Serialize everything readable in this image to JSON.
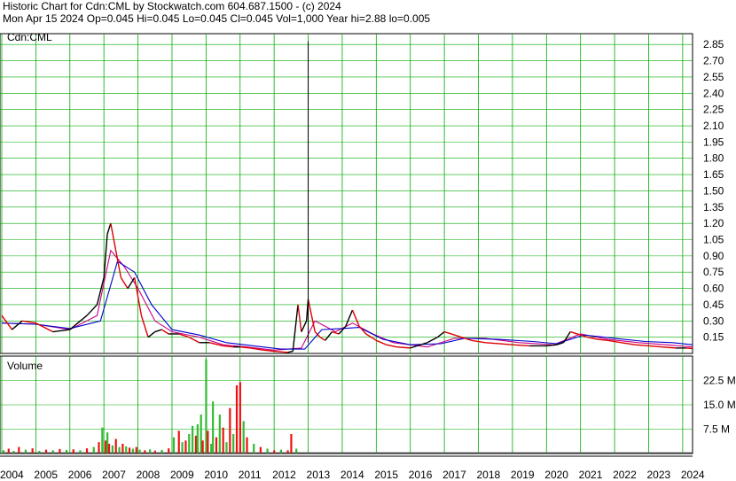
{
  "header": {
    "line1": "Historic Chart for Cdn:CML by Stockwatch.com 604.687.1500 - (c) 2024",
    "line2": "Mon Apr 15 2024   Op=0.045  Hi=0.045  Lo=0.045  Cl=0.045  Vol=1,000   Year hi=2.88  lo=0.005"
  },
  "colors": {
    "grid": "#00aa00",
    "price_black": "#000000",
    "price_red": "#dd0000",
    "ma_magenta": "#cc0088",
    "ma_blue": "#0000cc",
    "vol_green": "#33bb33",
    "vol_red": "#ee1111"
  },
  "chart_data": [
    {
      "type": "line",
      "title": "Cdn:CML",
      "x_years": [
        "2004",
        "2005",
        "2006",
        "2007",
        "2008",
        "2009",
        "2010",
        "2011",
        "2012",
        "2013",
        "2014",
        "2015",
        "2016",
        "2017",
        "2018",
        "2019",
        "2020",
        "2021",
        "2022",
        "2023",
        "2024"
      ],
      "ylim": [
        0,
        2.95
      ],
      "yticks": [
        "0.15",
        "0.30",
        "0.45",
        "0.60",
        "0.75",
        "0.90",
        "1.05",
        "1.20",
        "1.35",
        "1.50",
        "1.65",
        "1.80",
        "1.95",
        "2.10",
        "2.25",
        "2.40",
        "2.55",
        "2.70",
        "2.85"
      ],
      "grid": true,
      "series": [
        {
          "x": [
            2004.0,
            2004.3,
            2004.6,
            2005.0,
            2005.5,
            2006.0,
            2006.5,
            2006.8,
            2007.0,
            2007.1,
            2007.2,
            2007.35,
            2007.5,
            2007.7,
            2007.9,
            2008.1,
            2008.3,
            2008.5,
            2008.7,
            2008.9,
            2009.2,
            2009.5,
            2009.8,
            2010.1,
            2010.5,
            2010.8,
            2011.0,
            2011.3,
            2011.7,
            2012.0,
            2012.4,
            2012.55,
            2012.7,
            2012.8,
            2012.95,
            2013.0,
            2013.1,
            2013.2,
            2013.35,
            2013.5,
            2013.7,
            2013.9,
            2014.1,
            2014.3,
            2014.5,
            2014.7,
            2015.0,
            2015.3,
            2015.6,
            2016.0,
            2016.5,
            2016.8,
            2017.0,
            2017.2,
            2017.5,
            2017.8,
            2018.2,
            2018.6,
            2019.0,
            2019.5,
            2020.0,
            2020.3,
            2020.5,
            2020.7,
            2020.9,
            2021.2,
            2021.5,
            2021.8,
            2022.2,
            2022.6,
            2023.0,
            2023.4,
            2023.8,
            2024.1,
            2024.29
          ],
          "values": [
            0.35,
            0.22,
            0.3,
            0.28,
            0.2,
            0.22,
            0.35,
            0.45,
            0.7,
            1.1,
            1.2,
            0.95,
            0.7,
            0.6,
            0.7,
            0.35,
            0.15,
            0.2,
            0.22,
            0.18,
            0.18,
            0.15,
            0.1,
            0.1,
            0.07,
            0.06,
            0.06,
            0.05,
            0.03,
            0.02,
            0.01,
            0.02,
            0.45,
            0.2,
            0.3,
            0.5,
            0.35,
            0.2,
            0.15,
            0.12,
            0.2,
            0.18,
            0.25,
            0.4,
            0.25,
            0.18,
            0.12,
            0.08,
            0.06,
            0.05,
            0.1,
            0.15,
            0.2,
            0.18,
            0.15,
            0.12,
            0.1,
            0.09,
            0.08,
            0.07,
            0.07,
            0.08,
            0.1,
            0.2,
            0.18,
            0.15,
            0.13,
            0.12,
            0.1,
            0.08,
            0.07,
            0.06,
            0.05,
            0.05,
            0.045
          ]
        },
        {
          "x": [
            2004.0,
            2005.0,
            2006.0,
            2006.8,
            2007.2,
            2007.6,
            2008.0,
            2008.5,
            2009.0,
            2009.8,
            2010.5,
            2011.2,
            2012.0,
            2012.8,
            2013.2,
            2013.8,
            2014.3,
            2014.9,
            2015.5,
            2016.5,
            2017.3,
            2018.2,
            2019.2,
            2020.2,
            2021.0,
            2021.8,
            2022.7,
            2023.5,
            2024.29
          ],
          "values": [
            0.28,
            0.27,
            0.22,
            0.35,
            0.95,
            0.8,
            0.6,
            0.3,
            0.2,
            0.15,
            0.08,
            0.06,
            0.03,
            0.05,
            0.3,
            0.2,
            0.28,
            0.18,
            0.1,
            0.06,
            0.14,
            0.14,
            0.1,
            0.08,
            0.18,
            0.13,
            0.1,
            0.08,
            0.06
          ]
        },
        {
          "x": [
            2004.0,
            2005.0,
            2006.0,
            2006.9,
            2007.4,
            2007.9,
            2008.4,
            2009.0,
            2009.8,
            2010.6,
            2011.4,
            2012.2,
            2012.9,
            2013.4,
            2014.0,
            2014.5,
            2015.2,
            2016.0,
            2016.9,
            2017.6,
            2018.6,
            2019.6,
            2020.3,
            2021.1,
            2022.0,
            2022.9,
            2023.7,
            2024.29
          ],
          "values": [
            0.28,
            0.27,
            0.23,
            0.3,
            0.85,
            0.75,
            0.45,
            0.22,
            0.17,
            0.1,
            0.07,
            0.04,
            0.04,
            0.22,
            0.23,
            0.24,
            0.13,
            0.08,
            0.09,
            0.14,
            0.13,
            0.11,
            0.09,
            0.17,
            0.14,
            0.11,
            0.1,
            0.08
          ]
        }
      ]
    },
    {
      "type": "bar",
      "title": "Volume",
      "ylim": [
        0,
        30
      ],
      "yticks": [
        "7.5 M",
        "15.0 M",
        "22.5 M"
      ],
      "grid": true,
      "x": [
        2004.05,
        2004.2,
        2004.35,
        2004.5,
        2004.7,
        2004.9,
        2005.1,
        2005.3,
        2005.5,
        2005.7,
        2005.9,
        2006.1,
        2006.3,
        2006.5,
        2006.7,
        2006.85,
        2006.95,
        2007.05,
        2007.1,
        2007.15,
        2007.25,
        2007.35,
        2007.45,
        2007.55,
        2007.65,
        2007.75,
        2007.85,
        2007.95,
        2008.05,
        2008.2,
        2008.35,
        2008.5,
        2008.7,
        2008.9,
        2009.05,
        2009.2,
        2009.3,
        2009.4,
        2009.5,
        2009.6,
        2009.7,
        2009.75,
        2009.85,
        2009.9,
        2010.0,
        2010.05,
        2010.15,
        2010.2,
        2010.3,
        2010.4,
        2010.5,
        2010.6,
        2010.7,
        2010.8,
        2010.9,
        2011.0,
        2011.1,
        2011.2,
        2011.4,
        2011.6,
        2011.8,
        2012.0,
        2012.2,
        2012.4,
        2012.5,
        2012.65
      ],
      "values": [
        1.0,
        1.5,
        0.8,
        2.0,
        1.2,
        1.6,
        0.8,
        1.2,
        1.0,
        1.4,
        1.1,
        1.3,
        1.0,
        1.6,
        2.0,
        3.5,
        8.0,
        4.0,
        6.5,
        3.0,
        2.5,
        4.5,
        2.0,
        3.0,
        2.2,
        1.8,
        1.5,
        2.0,
        1.2,
        1.0,
        1.3,
        0.9,
        1.1,
        1.6,
        5.0,
        7.0,
        3.5,
        4.0,
        6.0,
        8.5,
        5.5,
        9.0,
        12.0,
        4.0,
        29.0,
        7.0,
        3.0,
        16.0,
        5.0,
        12.0,
        8.0,
        3.5,
        14.0,
        6.0,
        21.0,
        22.0,
        10.0,
        5.0,
        3.0,
        2.0,
        1.5,
        1.0,
        1.2,
        1.0,
        6.0,
        1.5
      ],
      "colors": [
        "g",
        "r",
        "g",
        "r",
        "g",
        "r",
        "g",
        "r",
        "g",
        "r",
        "g",
        "r",
        "g",
        "r",
        "g",
        "r",
        "g",
        "r",
        "g",
        "r",
        "g",
        "r",
        "g",
        "r",
        "g",
        "r",
        "g",
        "r",
        "g",
        "r",
        "g",
        "r",
        "g",
        "r",
        "g",
        "r",
        "g",
        "r",
        "g",
        "g",
        "r",
        "g",
        "g",
        "r",
        "g",
        "r",
        "g",
        "g",
        "r",
        "g",
        "r",
        "g",
        "r",
        "g",
        "r",
        "r",
        "g",
        "r",
        "g",
        "r",
        "g",
        "r",
        "g",
        "r",
        "r",
        "g"
      ]
    }
  ]
}
